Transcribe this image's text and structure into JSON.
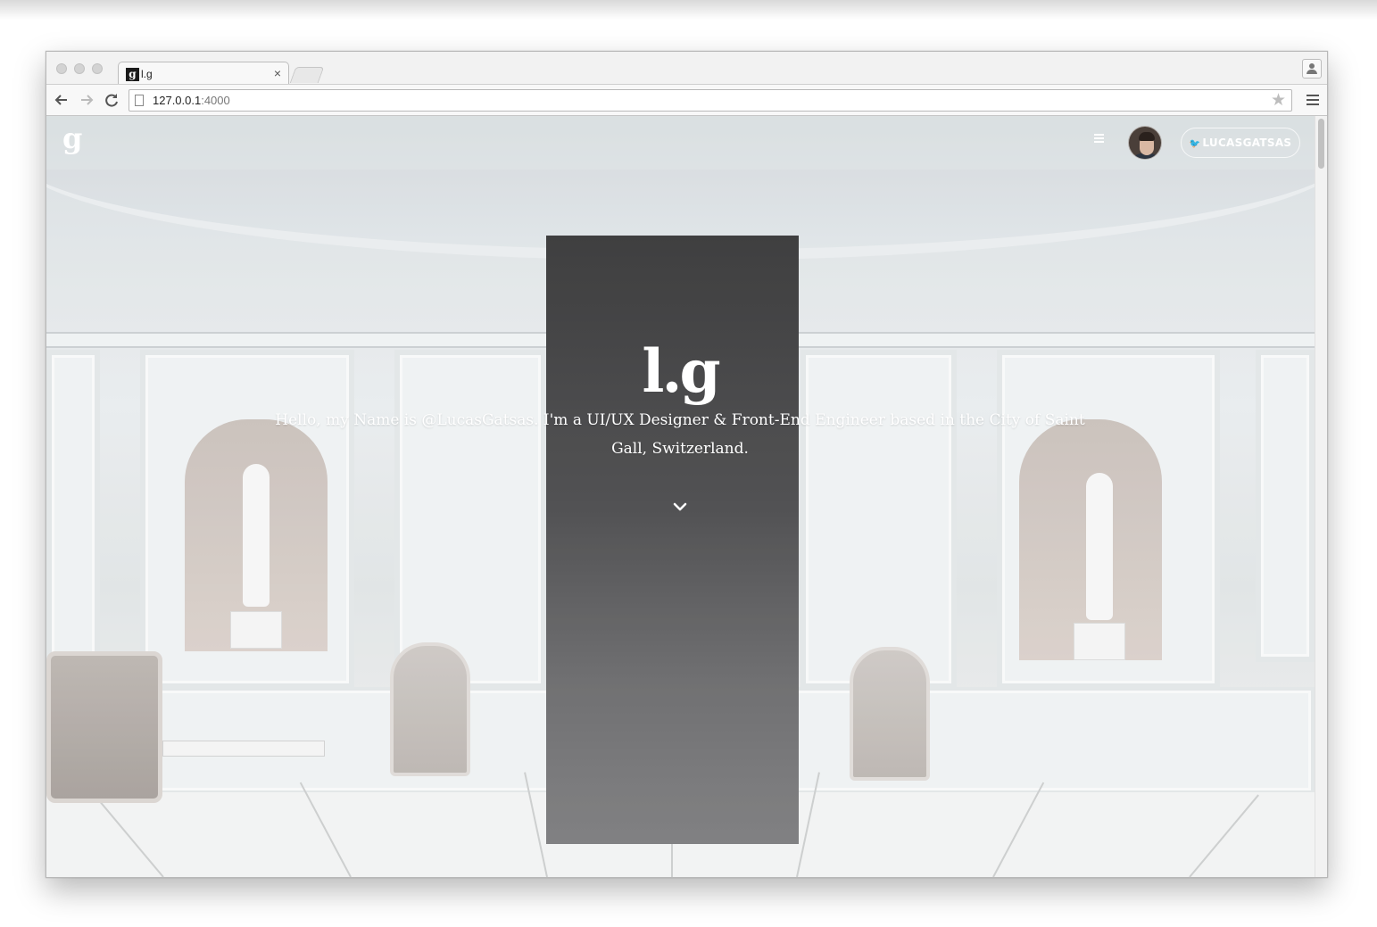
{
  "browser": {
    "tab": {
      "favicon": "g",
      "title": "l.g"
    },
    "close_symbol": "×",
    "url_host": "127.0.0.1",
    "url_port": ":4000",
    "icons": {
      "back": "back-arrow-icon",
      "forward": "forward-arrow-icon",
      "reload": "reload-icon",
      "star": "bookmark-star-icon",
      "menu": "menu-icon",
      "profile": "profile-icon"
    }
  },
  "site": {
    "logo": "g",
    "twitter_label": "LUCASGATSAS",
    "hero_mark": "l.g",
    "hero_text": "Hello, my Name is @LucasGatsas. I'm a UI/UX Designer & Front-End Engineer based in the City of Saint Gall, Switzerland.",
    "accent_color": "#ffffff"
  }
}
